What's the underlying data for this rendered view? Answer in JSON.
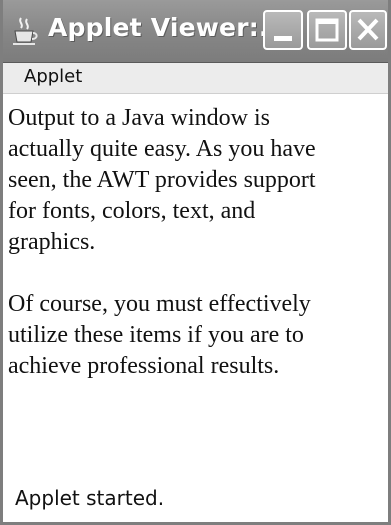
{
  "window": {
    "title": "Applet Viewer:...",
    "controls": {
      "minimize": "minimize-icon",
      "maximize": "maximize-icon",
      "close": "close-icon"
    }
  },
  "menubar": {
    "items": [
      {
        "label": "Applet"
      }
    ]
  },
  "content": {
    "paragraphs": [
      "Output to a Java window is\nactually quite easy. As you have\nseen, the AWT provides support\nfor fonts, colors, text, and\ngraphics.",
      "Of course, you must effectively\nutilize these items if you are to\nachieve professional results."
    ]
  },
  "status": {
    "text": "Applet started."
  },
  "colors": {
    "titlebar": "#868686",
    "title_text": "#ffffff",
    "menubar": "#ececec",
    "content_bg": "#ffffff"
  }
}
